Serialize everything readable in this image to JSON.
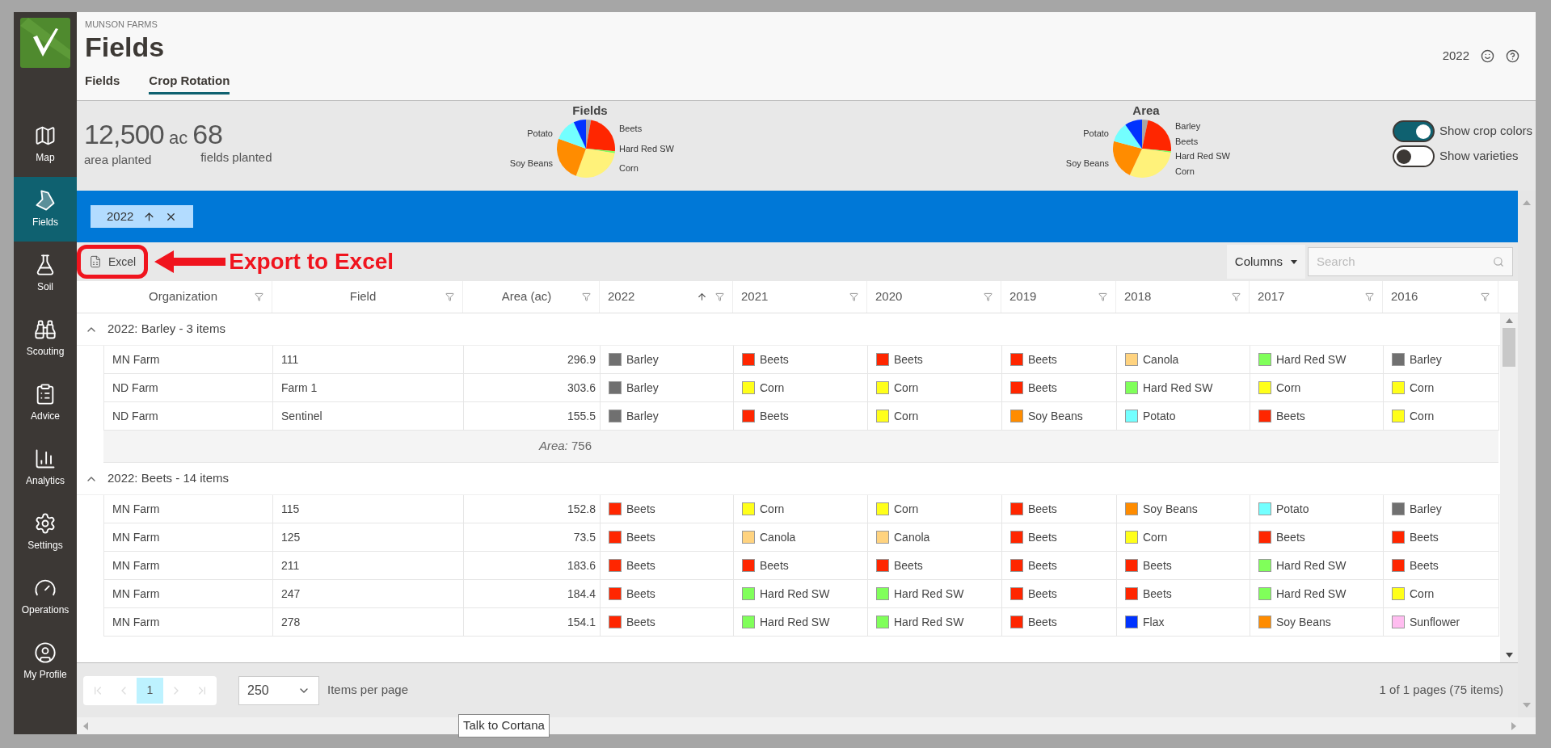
{
  "app": {
    "org": "MUNSON FARMS",
    "title": "Fields",
    "year": "2022"
  },
  "nav": [
    {
      "label": "Map",
      "selected": false
    },
    {
      "label": "Fields",
      "selected": true
    },
    {
      "label": "Soil",
      "selected": false
    },
    {
      "label": "Scouting",
      "selected": false
    },
    {
      "label": "Advice",
      "selected": false
    },
    {
      "label": "Analytics",
      "selected": false
    },
    {
      "label": "Settings",
      "selected": false
    },
    {
      "label": "Operations",
      "selected": false
    },
    {
      "label": "My Profile",
      "selected": false
    }
  ],
  "tabs": [
    {
      "label": "Fields",
      "selected": false
    },
    {
      "label": "Crop Rotation",
      "selected": true
    }
  ],
  "summary": {
    "area": "12,500",
    "area_unit": "ac",
    "fields": "68",
    "area_label": "area planted",
    "fields_label": "fields planted"
  },
  "pies": [
    {
      "title": "Fields",
      "left_labels": [
        "Potato",
        "Soy Beans"
      ],
      "right_labels": [
        "Beets",
        "Hard Red SW",
        "Corn"
      ]
    },
    {
      "title": "Area",
      "left_labels": [
        "Potato",
        "Soy Beans"
      ],
      "right_labels": [
        "Barley",
        "Beets",
        "Hard Red SW",
        "Corn"
      ]
    }
  ],
  "toggles": [
    {
      "label": "Show crop colors",
      "on": true
    },
    {
      "label": "Show varieties",
      "on": false
    }
  ],
  "group_chip": {
    "label": "2022",
    "ascending": true
  },
  "toolbar": {
    "export": "Excel",
    "columns": "Columns",
    "search_placeholder": "Search"
  },
  "annotation": {
    "text": "Export to Excel"
  },
  "columns": [
    {
      "label": "Organization",
      "sorted": false
    },
    {
      "label": "Field",
      "sorted": false
    },
    {
      "label": "Area (ac)",
      "sorted": false
    },
    {
      "label": "2022",
      "sorted": true
    },
    {
      "label": "2021",
      "sorted": false
    },
    {
      "label": "2020",
      "sorted": false
    },
    {
      "label": "2019",
      "sorted": false
    },
    {
      "label": "2018",
      "sorted": false
    },
    {
      "label": "2017",
      "sorted": false
    },
    {
      "label": "2016",
      "sorted": false
    }
  ],
  "groups": [
    {
      "title": "2022: Barley - 3 items",
      "expanded": true,
      "summary": "*Area:* 756",
      "rows": [
        {
          "org": "MN Farm",
          "field": "111",
          "area": "296.9",
          "crops": [
            {
              "name": "Barley",
              "color": "#707070"
            },
            {
              "name": "Beets",
              "color": "#ff2600"
            },
            {
              "name": "Beets",
              "color": "#ff2600"
            },
            {
              "name": "Beets",
              "color": "#ff2600"
            },
            {
              "name": "Canola",
              "color": "#ffd37f"
            },
            {
              "name": "Hard Red SW",
              "color": "#80ff5a"
            },
            {
              "name": "Barley",
              "color": "#707070"
            }
          ]
        },
        {
          "org": "ND Farm",
          "field": "Farm 1",
          "area": "303.6",
          "crops": [
            {
              "name": "Barley",
              "color": "#707070"
            },
            {
              "name": "Corn",
              "color": "#ffff1a"
            },
            {
              "name": "Corn",
              "color": "#ffff1a"
            },
            {
              "name": "Beets",
              "color": "#ff2600"
            },
            {
              "name": "Hard Red SW",
              "color": "#80ff5a"
            },
            {
              "name": "Corn",
              "color": "#ffff1a"
            },
            {
              "name": "Corn",
              "color": "#ffff1a"
            }
          ]
        },
        {
          "org": "ND Farm",
          "field": "Sentinel",
          "area": "155.5",
          "crops": [
            {
              "name": "Barley",
              "color": "#707070"
            },
            {
              "name": "Beets",
              "color": "#ff2600"
            },
            {
              "name": "Corn",
              "color": "#ffff1a"
            },
            {
              "name": "Soy Beans",
              "color": "#ff8c00"
            },
            {
              "name": "Potato",
              "color": "#73ffff"
            },
            {
              "name": "Beets",
              "color": "#ff2600"
            },
            {
              "name": "Corn",
              "color": "#ffff1a"
            }
          ]
        }
      ]
    },
    {
      "title": "2022: Beets - 14 items",
      "expanded": true,
      "rows": [
        {
          "org": "MN Farm",
          "field": "115",
          "area": "152.8",
          "crops": [
            {
              "name": "Beets",
              "color": "#ff2600"
            },
            {
              "name": "Corn",
              "color": "#ffff1a"
            },
            {
              "name": "Corn",
              "color": "#ffff1a"
            },
            {
              "name": "Beets",
              "color": "#ff2600"
            },
            {
              "name": "Soy Beans",
              "color": "#ff8c00"
            },
            {
              "name": "Potato",
              "color": "#73ffff"
            },
            {
              "name": "Barley",
              "color": "#707070"
            }
          ]
        },
        {
          "org": "MN Farm",
          "field": "125",
          "area": "73.5",
          "crops": [
            {
              "name": "Beets",
              "color": "#ff2600"
            },
            {
              "name": "Canola",
              "color": "#ffd37f"
            },
            {
              "name": "Canola",
              "color": "#ffd37f"
            },
            {
              "name": "Beets",
              "color": "#ff2600"
            },
            {
              "name": "Corn",
              "color": "#ffff1a"
            },
            {
              "name": "Beets",
              "color": "#ff2600"
            },
            {
              "name": "Beets",
              "color": "#ff2600"
            }
          ]
        },
        {
          "org": "MN Farm",
          "field": "211",
          "area": "183.6",
          "crops": [
            {
              "name": "Beets",
              "color": "#ff2600"
            },
            {
              "name": "Beets",
              "color": "#ff2600"
            },
            {
              "name": "Beets",
              "color": "#ff2600"
            },
            {
              "name": "Beets",
              "color": "#ff2600"
            },
            {
              "name": "Beets",
              "color": "#ff2600"
            },
            {
              "name": "Hard Red SW",
              "color": "#80ff5a"
            },
            {
              "name": "Beets",
              "color": "#ff2600"
            }
          ]
        },
        {
          "org": "MN Farm",
          "field": "247",
          "area": "184.4",
          "crops": [
            {
              "name": "Beets",
              "color": "#ff2600"
            },
            {
              "name": "Hard Red SW",
              "color": "#80ff5a"
            },
            {
              "name": "Hard Red SW",
              "color": "#80ff5a"
            },
            {
              "name": "Beets",
              "color": "#ff2600"
            },
            {
              "name": "Beets",
              "color": "#ff2600"
            },
            {
              "name": "Hard Red SW",
              "color": "#80ff5a"
            },
            {
              "name": "Corn",
              "color": "#ffff1a"
            }
          ]
        },
        {
          "org": "MN Farm",
          "field": "278",
          "area": "154.1",
          "crops": [
            {
              "name": "Beets",
              "color": "#ff2600"
            },
            {
              "name": "Hard Red SW",
              "color": "#80ff5a"
            },
            {
              "name": "Hard Red SW",
              "color": "#80ff5a"
            },
            {
              "name": "Beets",
              "color": "#ff2600"
            },
            {
              "name": "Flax",
              "color": "#0033ff"
            },
            {
              "name": "Soy Beans",
              "color": "#ff8c00"
            },
            {
              "name": "Sunflower",
              "color": "#ffbdf0"
            }
          ]
        }
      ]
    }
  ],
  "pager": {
    "pages": [
      {
        "label": "1",
        "selected": true
      }
    ],
    "page_size": "250",
    "page_size_label": "Items per page",
    "info": "1 of 1 pages (75 items)"
  },
  "tooltip": "Talk to Cortana"
}
